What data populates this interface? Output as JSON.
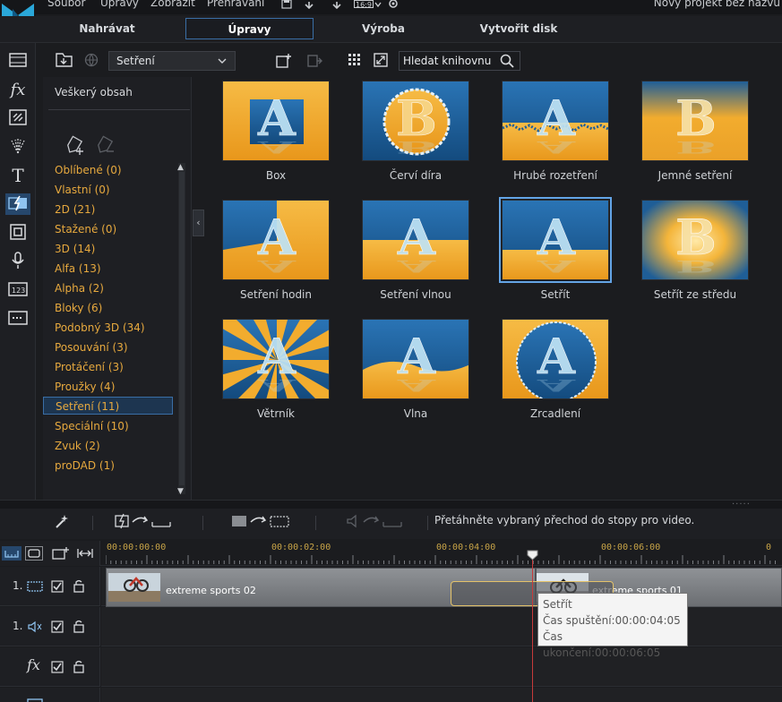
{
  "menu": [
    "Soubor",
    "Úpravy",
    "Zobrazit",
    "Přehrávání"
  ],
  "aspect_ratio": "16:9",
  "project_title": "Nový projekt bez názvu",
  "modes": [
    {
      "label": "Nahrávat"
    },
    {
      "label": "Úpravy"
    },
    {
      "label": "Výroba"
    },
    {
      "label": "Vytvořit disk"
    }
  ],
  "rail_icons": [
    "media-icon",
    "fx-icon",
    "overlay-icon",
    "particle-icon",
    "title-icon",
    "transition-icon",
    "pip-icon",
    "microphone-icon",
    "chapter-icon",
    "subtitle-icon"
  ],
  "library": {
    "category_selected": "Setření",
    "search_placeholder": "Hledat knihovnu"
  },
  "category_panel": {
    "all_content": "Veškerý obsah",
    "items": [
      {
        "label": "Oblíbené  (0)"
      },
      {
        "label": "Vlastní  (0)"
      },
      {
        "label": "2D  (21)"
      },
      {
        "label": "Stažené  (0)"
      },
      {
        "label": "3D  (14)"
      },
      {
        "label": "Alfa  (13)"
      },
      {
        "label": "Alpha  (2)"
      },
      {
        "label": "Bloky  (6)"
      },
      {
        "label": "Podobný 3D  (34)"
      },
      {
        "label": "Posouvání  (3)"
      },
      {
        "label": "Protáčení  (3)"
      },
      {
        "label": "Proužky  (4)"
      },
      {
        "label": "Setření  (11)"
      },
      {
        "label": "Speciální  (10)"
      },
      {
        "label": "Zvuk  (2)"
      },
      {
        "label": "proDAD  (1)"
      }
    ]
  },
  "transitions": [
    {
      "label": "Box",
      "glyph": "A"
    },
    {
      "label": "Červí díra",
      "glyph": "B"
    },
    {
      "label": "Hrubé rozetření",
      "glyph": "A"
    },
    {
      "label": "Jemné setření",
      "glyph": "B"
    },
    {
      "label": "Setření hodin",
      "glyph": "A"
    },
    {
      "label": "Setření vlnou",
      "glyph": "A"
    },
    {
      "label": "Setřít",
      "glyph": "A"
    },
    {
      "label": "Setřít ze středu",
      "glyph": "B"
    },
    {
      "label": "Větrník",
      "glyph": "A"
    },
    {
      "label": "Vlna",
      "glyph": "A"
    },
    {
      "label": "Zrcadlení",
      "glyph": "A"
    }
  ],
  "timeline": {
    "hint": "Přetáhněte vybraný přechod do stopy pro video.",
    "ruler": [
      "00:00:00:00",
      "00:00:02:00",
      "00:00:04:00",
      "00:00:06:00"
    ],
    "tracks": [
      {
        "num": "1."
      },
      {
        "num": "1."
      },
      {
        "num": ""
      },
      {
        "num": ""
      }
    ],
    "clips": [
      {
        "label": "extreme sports 02"
      },
      {
        "label": "extreme sports 01"
      }
    ],
    "tooltip": {
      "name": "Setřít",
      "start": "Čas spuštění:00:00:04:05",
      "end": "Čas ukončení:00:00:06:05"
    }
  },
  "colors": {
    "accent": "#3a6ea6",
    "category_text": "#e7a93e",
    "thumb_blue": "#1f5e97",
    "thumb_orange": "#f1a524"
  }
}
